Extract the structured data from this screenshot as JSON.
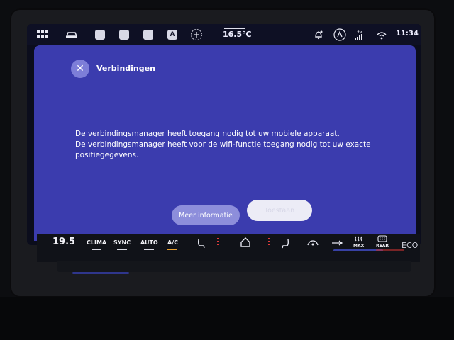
{
  "status": {
    "temperature": "16.5℃",
    "network": "4G",
    "time": "11:34"
  },
  "dialog": {
    "title": "Verbindingen",
    "message_line1": "De verbindingsmanager heeft toegang nodig tot uw mobiele apparaat.",
    "message_line2": "De verbindingsmanager heeft voor de wifi-functie toegang nodig tot uw exacte positiegegevens.",
    "more_info_label": "Meer informatie",
    "allow_label": "Toestaan"
  },
  "climate": {
    "temperature": "19.5",
    "clima_label": "CLIMA",
    "sync_label": "SYNC",
    "auto_label": "AUTO",
    "ac_label": "A/C",
    "max_label": "MAX",
    "rear_label": "REAR",
    "eco_label": "ECO"
  },
  "colors": {
    "dialog_bg": "#3b3cae",
    "accent": "#8d8edb"
  }
}
